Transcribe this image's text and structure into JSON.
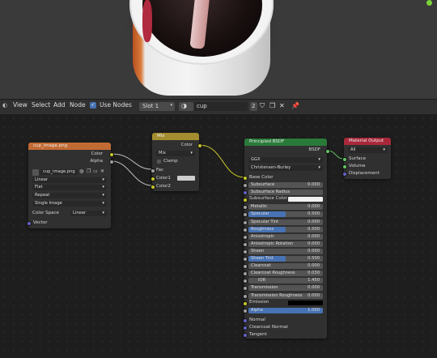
{
  "header": {
    "menus": [
      "View",
      "Select",
      "Add",
      "Node"
    ],
    "use_nodes_label": "Use Nodes",
    "slot": "Slot 1",
    "material_name": "cup",
    "user_count": "2"
  },
  "nodes": {
    "image_texture": {
      "title": "cup_image.png",
      "outputs": [
        "Color",
        "Alpha"
      ],
      "image_name": "cup_image.png",
      "interpolation": "Linear",
      "projection": "Flat",
      "extension": "Repeat",
      "source": "Single Image",
      "color_space_label": "Color Space",
      "color_space": "Linear",
      "input": "Vector"
    },
    "mix": {
      "title": "Mix",
      "output": "Color",
      "blend_type": "Mix",
      "clamp_label": "Clamp",
      "inputs": [
        "Fac",
        "Color1",
        "Color2"
      ]
    },
    "principled": {
      "title": "Principled BSDF",
      "output": "BSDF",
      "distribution": "GGX",
      "subsurface_method": "Christensen-Burley",
      "base_color": "Base Color",
      "rows": [
        {
          "label": "Subsurface",
          "value": "0.000",
          "fill": 0
        },
        {
          "label": "Subsurface Radius",
          "value": "",
          "fill": 0
        },
        {
          "label": "Subsurface Color",
          "value": "",
          "fill": 0
        },
        {
          "label": "Metallic",
          "value": "0.000",
          "fill": 0
        },
        {
          "label": "Specular",
          "value": "0.500",
          "fill": 0.5
        },
        {
          "label": "Specular Tint",
          "value": "0.000",
          "fill": 0
        },
        {
          "label": "Roughness",
          "value": "0.500",
          "fill": 0.5
        },
        {
          "label": "Anisotropic",
          "value": "0.000",
          "fill": 0
        },
        {
          "label": "Anisotropic Rotation",
          "value": "0.000",
          "fill": 0
        },
        {
          "label": "Sheen",
          "value": "0.000",
          "fill": 0
        },
        {
          "label": "Sheen Tint",
          "value": "0.500",
          "fill": 0.5
        },
        {
          "label": "Clearcoat",
          "value": "0.000",
          "fill": 0
        },
        {
          "label": "Clearcoat Roughness",
          "value": "0.030",
          "fill": 0
        },
        {
          "label": "IOR",
          "value": "1.450",
          "fill": 0
        },
        {
          "label": "Transmission",
          "value": "0.000",
          "fill": 0
        },
        {
          "label": "Transmission Roughness",
          "value": "0.000",
          "fill": 0
        },
        {
          "label": "Emission",
          "value": "",
          "fill": 0
        },
        {
          "label": "Alpha",
          "value": "1.000",
          "fill": 1
        }
      ],
      "vector_inputs": [
        "Normal",
        "Clearcoat Normal",
        "Tangent"
      ]
    },
    "material_output": {
      "title": "Material Output",
      "target": "All",
      "inputs": [
        "Surface",
        "Volume",
        "Displacement"
      ]
    }
  },
  "colors": {
    "texture_header": "#c26a33",
    "mix_header": "#a38d2f",
    "shader_header": "#2a7a3a",
    "output_header": "#a8283a",
    "slider_fill": "#4772b3"
  }
}
